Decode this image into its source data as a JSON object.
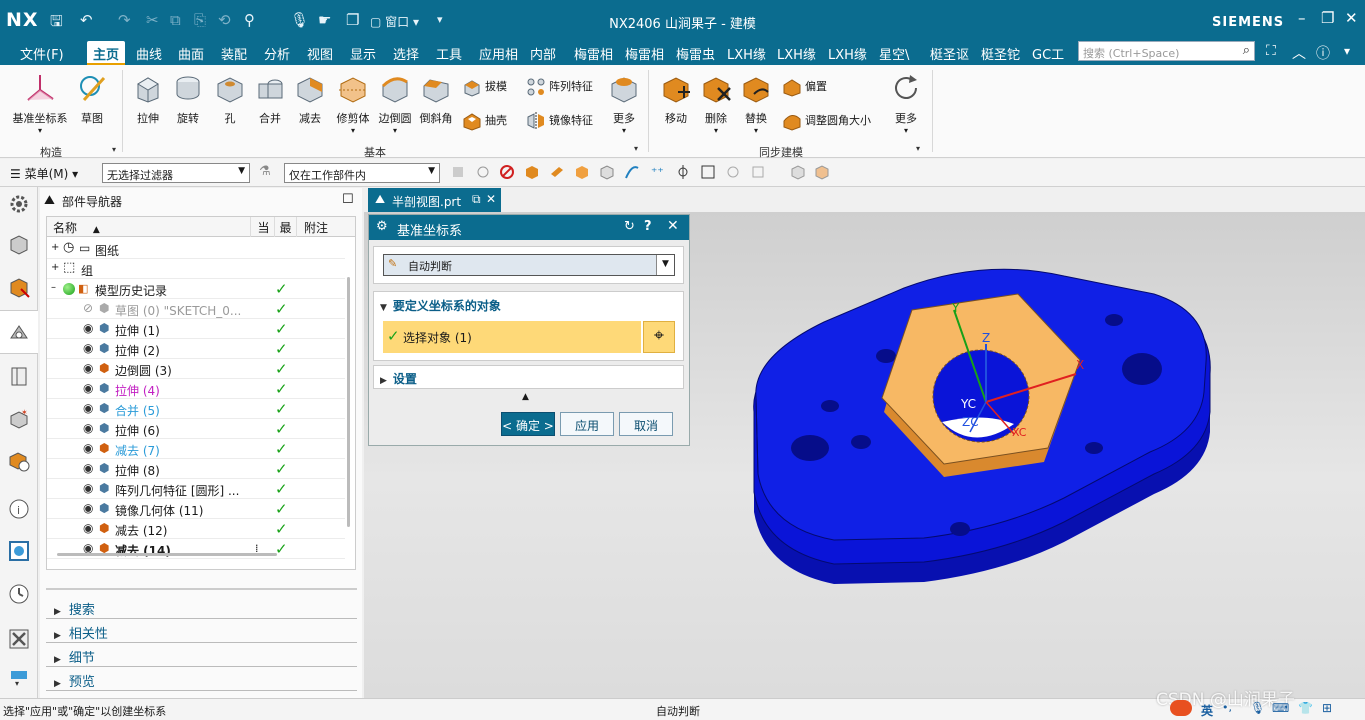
{
  "app": {
    "logo": "NX",
    "title": "NX2406 山涧果子 - 建模",
    "brand": "SIEMENS",
    "window_menu": "窗口"
  },
  "menubar": {
    "items": [
      "文件(F)",
      "主页",
      "曲线",
      "曲面",
      "装配",
      "分析",
      "视图",
      "显示",
      "选择",
      "工具",
      "应用相",
      "内部",
      "梅雷相",
      "梅雷相",
      "梅雷虫",
      "LXH缘",
      "LXH缘",
      "LXH缘",
      "星空\\",
      "梃圣讴",
      "梃圣铊",
      "GC工"
    ],
    "active_index": 1,
    "search_placeholder": "搜索 (Ctrl+Space)"
  },
  "ribbon": {
    "construct": {
      "datum_csys": "基准坐标系",
      "sketch": "草图",
      "group": "构造"
    },
    "basic": {
      "items": [
        "拉伸",
        "旋转",
        "孔",
        "合并",
        "减去",
        "修剪体",
        "边倒圆",
        "倒斜角"
      ],
      "small": [
        "拔模",
        "阵列特征",
        "抽壳",
        "镜像特征"
      ],
      "more": "更多",
      "group": "基本"
    },
    "sync": {
      "items": [
        "移动",
        "删除",
        "替换"
      ],
      "small": [
        "偏置",
        "调整圆角大小"
      ],
      "more": "更多",
      "group": "同步建模"
    }
  },
  "selbar": {
    "menu": "菜单(M)",
    "filter": "无选择过滤器",
    "scope": "仅在工作部件内"
  },
  "navigator": {
    "title": "部件导航器",
    "headers": {
      "name": "名称",
      "current": "当",
      "latest": "最",
      "note": "附注"
    },
    "top_rows": [
      {
        "label": "图纸"
      },
      {
        "label": "组"
      },
      {
        "label": "模型历史记录"
      }
    ],
    "features": [
      {
        "label": "草图 (0) \"SKETCH_0...",
        "color": "#9a9a9a",
        "bold": false
      },
      {
        "label": "拉伸 (1)",
        "color": "#1a1a1a",
        "bold": false
      },
      {
        "label": "拉伸 (2)",
        "color": "#1a1a1a",
        "bold": false
      },
      {
        "label": "边倒圆 (3)",
        "color": "#1a1a1a",
        "bold": false
      },
      {
        "label": "拉伸 (4)",
        "color": "#c21fc2",
        "bold": false
      },
      {
        "label": "合并 (5)",
        "color": "#2a9bd8",
        "bold": false
      },
      {
        "label": "拉伸 (6)",
        "color": "#1a1a1a",
        "bold": false
      },
      {
        "label": "减去 (7)",
        "color": "#2a9bd8",
        "bold": false
      },
      {
        "label": "拉伸 (8)",
        "color": "#1a1a1a",
        "bold": false
      },
      {
        "label": "阵列几何特征 [圆形] ...",
        "color": "#1a1a1a",
        "bold": false
      },
      {
        "label": "镜像几何体 (11)",
        "color": "#1a1a1a",
        "bold": false
      },
      {
        "label": "减去 (12)",
        "color": "#1a1a1a",
        "bold": false
      },
      {
        "label": "减去 (14)",
        "color": "#1a1a1a",
        "bold": true
      }
    ],
    "sections": [
      "搜索",
      "相关性",
      "细节",
      "预览"
    ]
  },
  "tab": {
    "label": "半剖视图.prt"
  },
  "dialog": {
    "title": "基准坐标系",
    "type_value": "自动判断",
    "section_objects": "要定义坐标系的对象",
    "select_label": "选择对象 (1)",
    "section_settings": "设置",
    "ok": "< 确定 >",
    "apply": "应用",
    "cancel": "取消"
  },
  "viewport": {
    "axes": {
      "x": "X",
      "y": "Y",
      "z": "Z",
      "xc": "XC",
      "yc": "YC",
      "zc": "ZC"
    },
    "colors": {
      "part": "#0a14d8",
      "nut": "#f7b864",
      "background": "#dcdcdc"
    }
  },
  "status": {
    "prompt": "选择\"应用\"或\"确定\"以创建坐标系",
    "mode": "自动判断",
    "watermark": "CSDN @山涧果子",
    "ime": "英"
  }
}
